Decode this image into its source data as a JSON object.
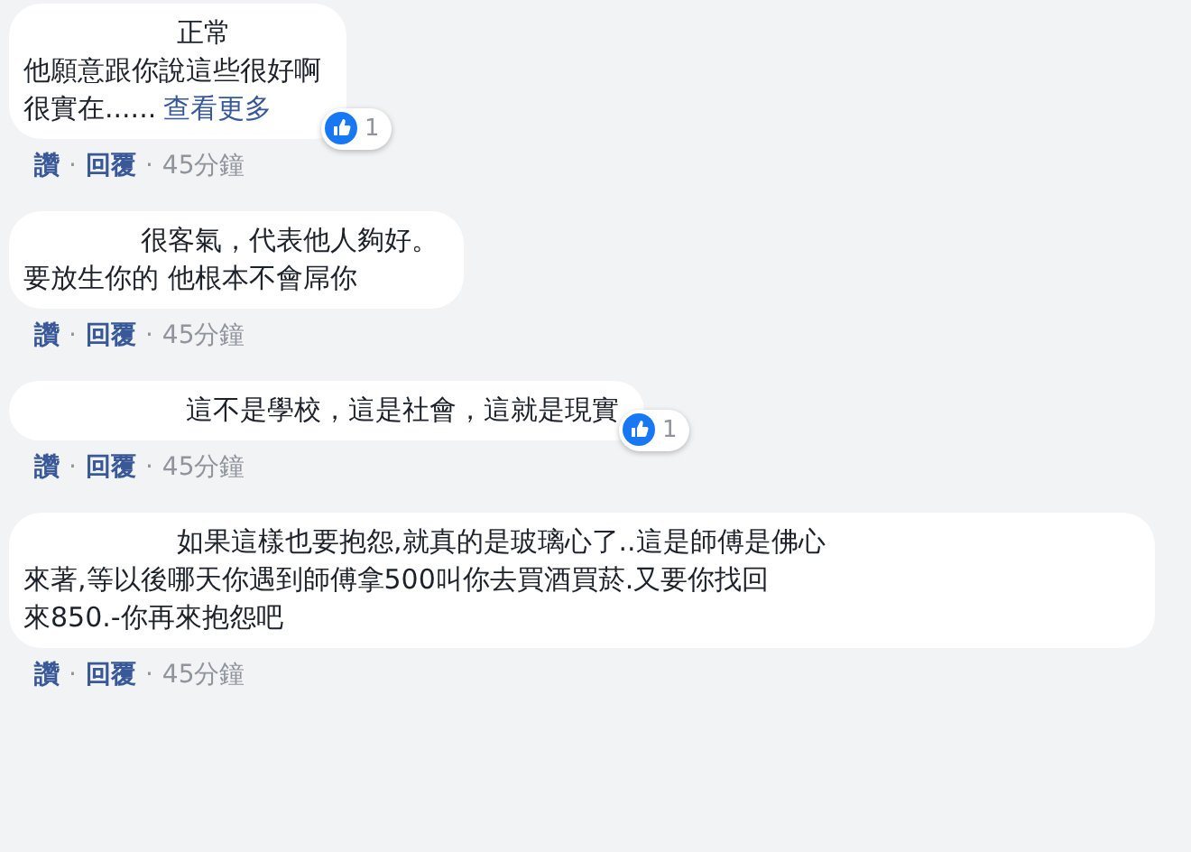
{
  "comments": [
    {
      "lines": [
        "正常",
        "他願意跟你說這些很好啊",
        "很實在......"
      ],
      "more_link": "查看更多",
      "reaction": {
        "count": "1"
      },
      "actions": [
        "讚",
        "回覆"
      ],
      "time": "45分鐘"
    },
    {
      "lines": [
        "很客氣，代表他人夠好。",
        "要放生你的 他根本不會屌你"
      ],
      "actions": [
        "讚",
        "回覆"
      ],
      "time": "45分鐘"
    },
    {
      "lines": [
        "這不是學校，這是社會，這就是現實"
      ],
      "reaction": {
        "count": "1"
      },
      "actions": [
        "讚",
        "回覆"
      ],
      "time": "45分鐘"
    },
    {
      "lines": [
        "如果這樣也要抱怨,就真的是玻璃心了..這是師傅是佛心",
        "來著,等以後哪天你遇到師傅拿500叫你去買酒買菸.又要你找回",
        "來850.-你再來抱怨吧"
      ],
      "actions": [
        "讚",
        "回覆"
      ],
      "time": "45分鐘"
    }
  ],
  "separator": "·"
}
